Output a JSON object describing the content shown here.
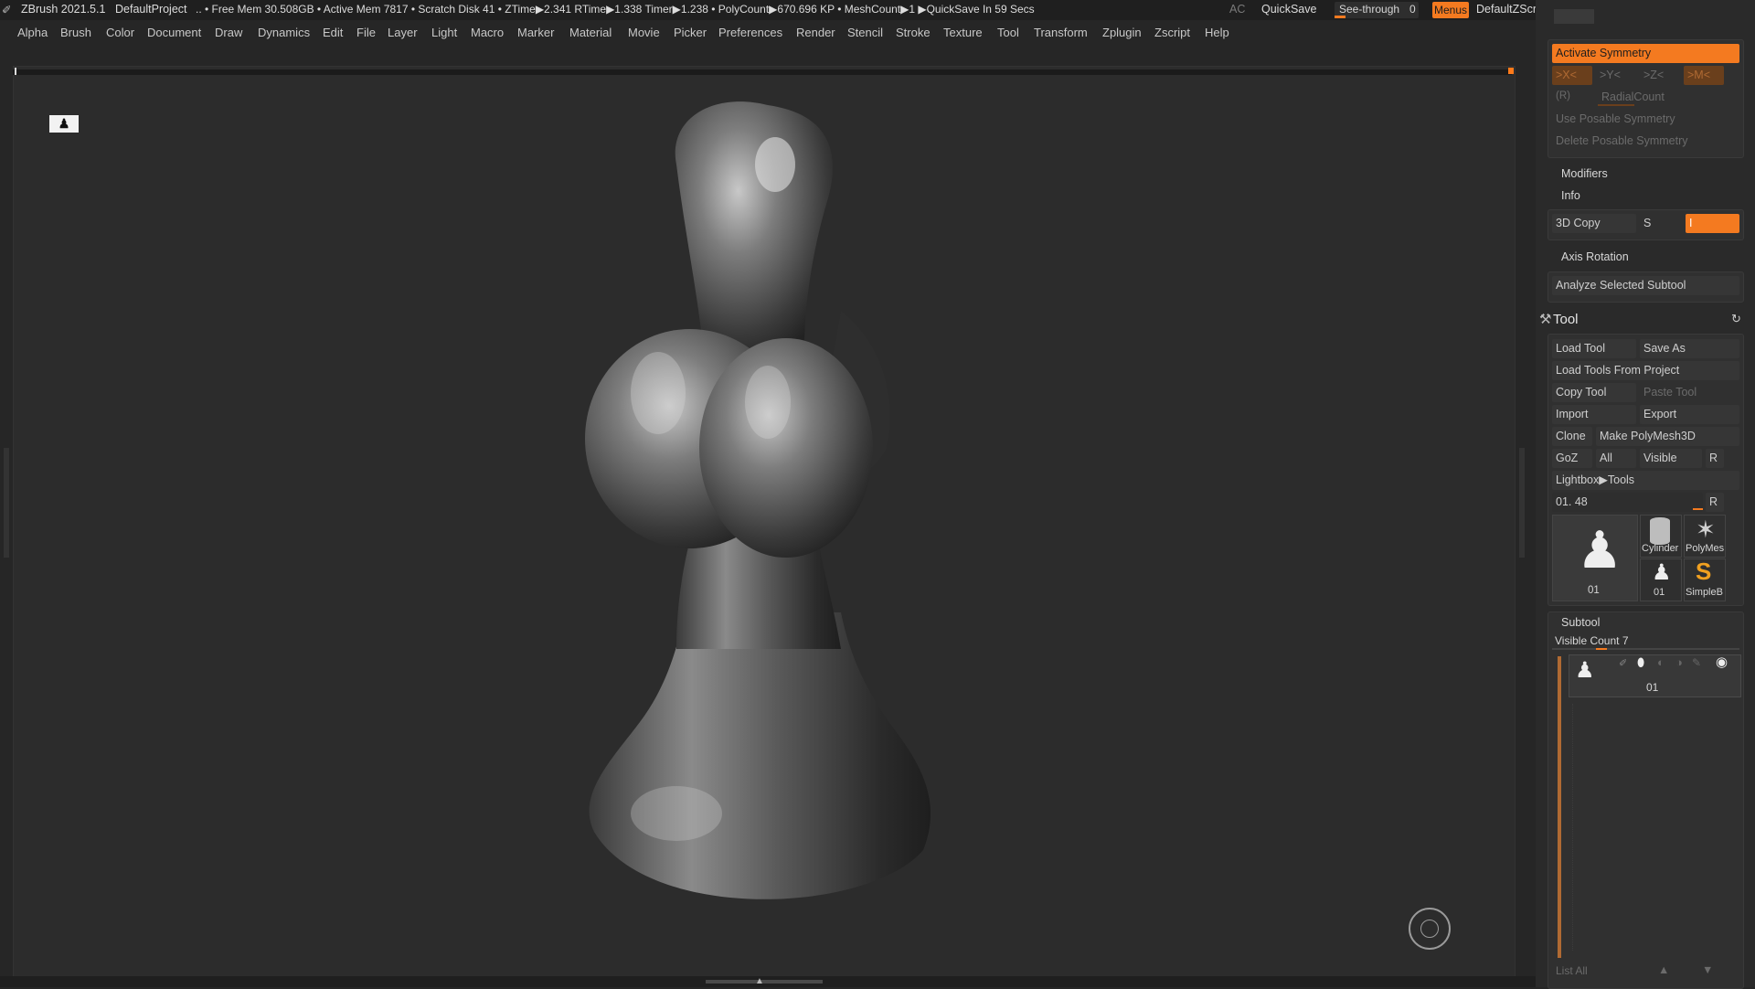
{
  "titlebar": {
    "app": "ZBrush 2021.5.1",
    "project": "DefaultProject",
    "stats": ".. • Free Mem 30.508GB • Active Mem 7817 • Scratch Disk 41 •  ZTime▶2.341 RTime▶1.338 Timer▶1.238 • PolyCount▶670.696 KP  • MeshCount▶1  ▶QuickSave In 59 Secs",
    "ac": "AC",
    "quicksave": "QuickSave",
    "seethrough_label": "See-through",
    "seethrough_value": "0",
    "menus": "Menus",
    "default_zscript": "DefaultZScript"
  },
  "menubar": [
    "Alpha",
    "Brush",
    "Color",
    "Document",
    "Draw",
    "Dynamics",
    "Edit",
    "File",
    "Layer",
    "Light",
    "Macro",
    "Marker",
    "Material",
    "Movie",
    "Picker",
    "Preferences",
    "Render",
    "Stencil",
    "Stroke",
    "Texture",
    "Tool",
    "Transform",
    "Zplugin",
    "Zscript",
    "Help"
  ],
  "symmetry": {
    "activate": "Activate Symmetry",
    "x": ">X<",
    "y": ">Y<",
    "z": ">Z<",
    "m": ">M<",
    "r": "(R)",
    "radial": "RadialCount",
    "use_posable": "Use Posable Symmetry",
    "delete_posable": "Delete Posable Symmetry"
  },
  "sections": {
    "modifiers": "Modifiers",
    "info": "Info",
    "copy3d": "3D Copy",
    "s": "S",
    "i": "I",
    "axis_rotation": "Axis Rotation",
    "analyze": "Analyze Selected Subtool"
  },
  "tool": {
    "title": "Tool",
    "load_tool": "Load Tool",
    "save_as": "Save As",
    "load_from_project": "Load Tools From Project",
    "copy_tool": "Copy Tool",
    "paste_tool": "Paste Tool",
    "import": "Import",
    "export": "Export",
    "clone": "Clone",
    "make_polymesh": "Make PolyMesh3D",
    "goz": "GoZ",
    "all": "All",
    "visible": "Visible",
    "r": "R",
    "lightbox": "Lightbox▶Tools",
    "tool_slider": "01. 48",
    "thumb_main": "01",
    "thumb_cylinder": "Cylinder",
    "thumb_polymesh": "PolyMes",
    "thumb_small": "01",
    "thumb_simple": "SimpleB"
  },
  "subtool": {
    "title": "Subtool",
    "visible_count": "Visible Count 7",
    "item_label": "01",
    "list_all": "List All"
  },
  "colors": {
    "accent": "#f47a20",
    "background": "#262626",
    "panel": "#2a2a2a"
  }
}
